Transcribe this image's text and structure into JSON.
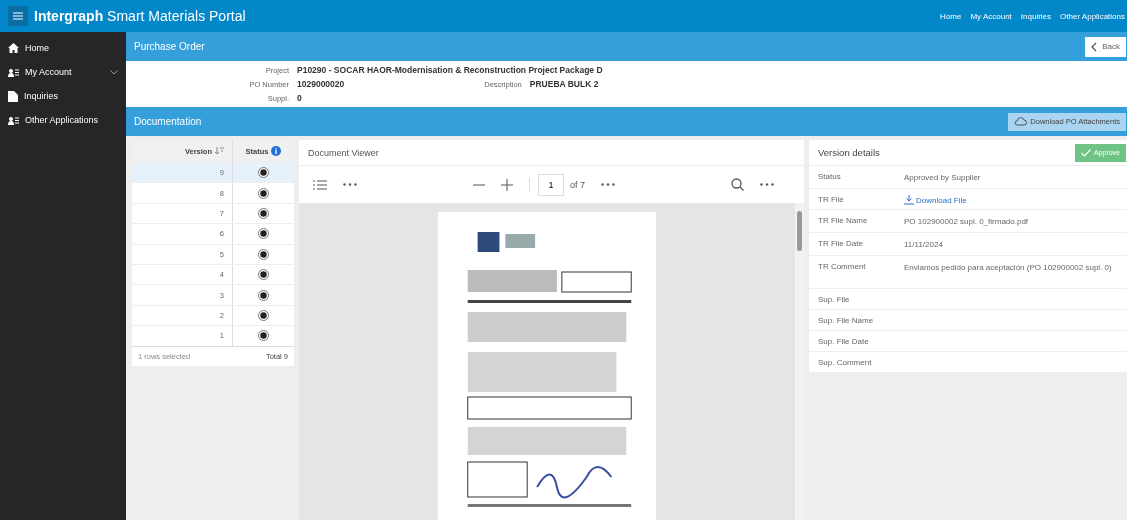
{
  "app_title": {
    "brand": "Intergraph",
    "rest": "Smart Materials Portal"
  },
  "top_nav": [
    "Home",
    "My Account",
    "Inquiries",
    "Other Applications"
  ],
  "sidebar": {
    "items": [
      {
        "label": "Home",
        "kind": "home",
        "expandable": false
      },
      {
        "label": "My Account",
        "kind": "account",
        "expandable": true
      },
      {
        "label": "Inquiries",
        "kind": "document",
        "expandable": false
      },
      {
        "label": "Other Applications",
        "kind": "account",
        "expandable": false
      }
    ]
  },
  "purchase_order": {
    "title": "Purchase Order",
    "back": "Back",
    "fields": [
      {
        "label": "Project",
        "value": "P10290 - SOCAR HAOR-Modernisation & Reconstruction Project Package D"
      },
      {
        "label": "PO Number",
        "value": "1029000020",
        "extra_label": "Description",
        "extra_value": "PRUEBA BULK 2"
      },
      {
        "label": "Suppl.",
        "value": "0"
      }
    ]
  },
  "documentation": {
    "title": "Documentation",
    "download": "Download PO Attachments"
  },
  "versions": {
    "columns": [
      "Version",
      "Status"
    ],
    "rows": [
      {
        "version": "9",
        "selected": true
      },
      {
        "version": "8",
        "selected": false
      },
      {
        "version": "7",
        "selected": false
      },
      {
        "version": "6",
        "selected": false
      },
      {
        "version": "5",
        "selected": false
      },
      {
        "version": "4",
        "selected": false
      },
      {
        "version": "3",
        "selected": false
      },
      {
        "version": "2",
        "selected": false
      },
      {
        "version": "1",
        "selected": false
      }
    ],
    "footer_left": "1 rows selected",
    "footer_right": "Total 9"
  },
  "viewer": {
    "title": "Document Viewer",
    "page": "1",
    "of": "of 7"
  },
  "details": {
    "title": "Version details",
    "approve": "Approve",
    "rows": [
      {
        "label": "Status",
        "value": "Approved by Supplier",
        "kind": "text"
      },
      {
        "label": "TR File",
        "value": "Download File",
        "kind": "link"
      },
      {
        "label": "TR File Name",
        "value": "PO 102900002 supl. 0_firmado.pdf",
        "kind": "text"
      },
      {
        "label": "TR File Date",
        "value": "11/11/2024",
        "kind": "text"
      },
      {
        "label": "TR Comment",
        "value": "Enviamos pedido para aceptación (PO 102900002 supl. 0)",
        "kind": "text"
      },
      {
        "label": "Sup. File",
        "kind": "text"
      },
      {
        "label": "Sup. File Name",
        "kind": "text"
      },
      {
        "label": "Sup. File Date",
        "kind": "text"
      },
      {
        "label": "Sup. Comment",
        "kind": "text"
      }
    ]
  }
}
